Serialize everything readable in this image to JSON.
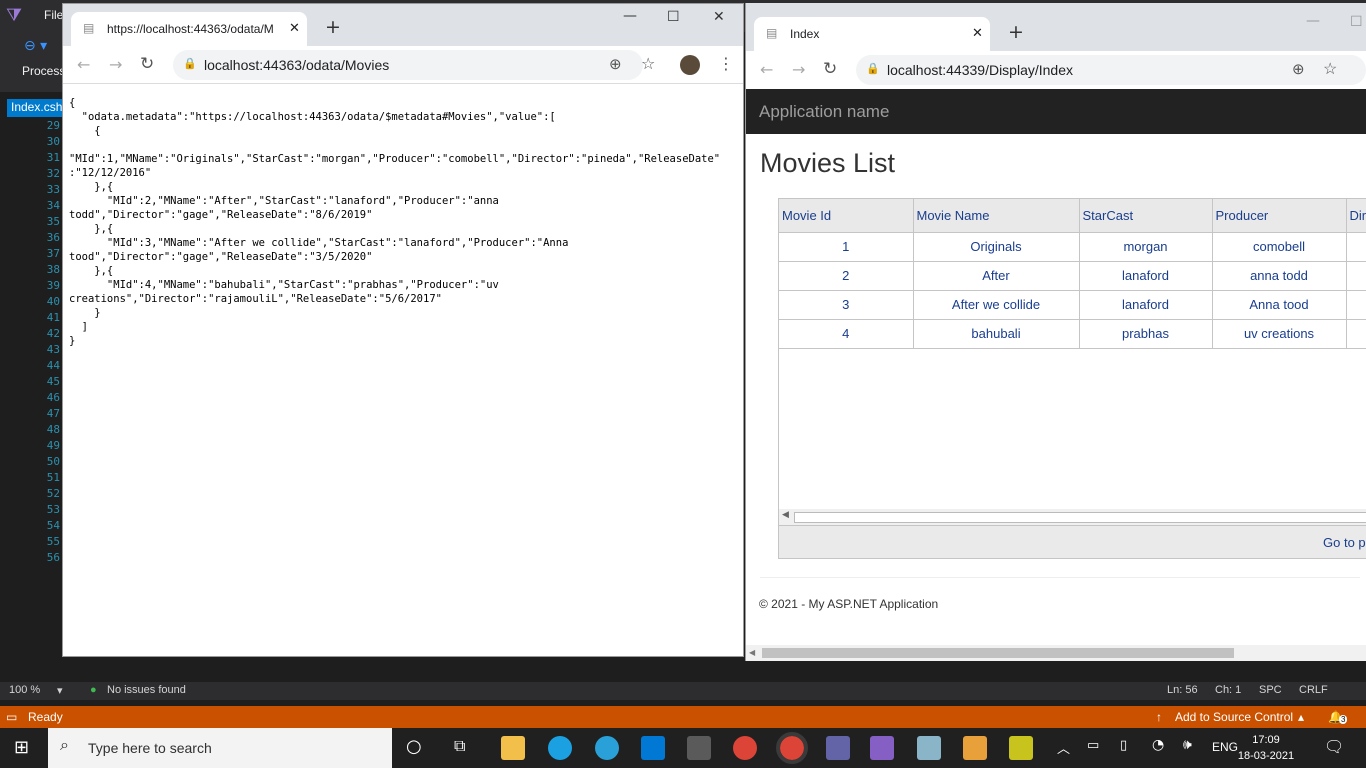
{
  "vs": {
    "menu_file": "File",
    "toolbar_process": "Process",
    "doc_tab": "Index.cshtml",
    "line_numbers": [
      "29",
      "30",
      "31",
      "32",
      "33",
      "34",
      "35",
      "36",
      "37",
      "38",
      "39",
      "40",
      "41",
      "42",
      "43",
      "44",
      "45",
      "46",
      "47",
      "48",
      "49",
      "50",
      "51",
      "52",
      "53",
      "54",
      "55",
      "56"
    ],
    "zoom": "100 %",
    "issues": "No issues found",
    "ln": "Ln: 56",
    "ch": "Ch: 1",
    "spc": "SPC",
    "crlf": "CRLF",
    "ready": "Ready",
    "source_control": "Add to Source Control",
    "notification_count": "3"
  },
  "browser1": {
    "tab_title": "https://localhost:44363/odata/M",
    "url": "localhost:44363/odata/Movies",
    "json_lines": [
      "{",
      "  \"odata.metadata\":\"https://localhost:44363/odata/$metadata#Movies\",\"value\":[",
      "    {",
      "",
      "\"MId\":1,\"MName\":\"Originals\",\"StarCast\":\"morgan\",\"Producer\":\"comobell\",\"Director\":\"pineda\",\"ReleaseDate\"",
      ":\"12/12/2016\"",
      "    },{",
      "      \"MId\":2,\"MName\":\"After\",\"StarCast\":\"lanaford\",\"Producer\":\"anna",
      "todd\",\"Director\":\"gage\",\"ReleaseDate\":\"8/6/2019\"",
      "    },{",
      "      \"MId\":3,\"MName\":\"After we collide\",\"StarCast\":\"lanaford\",\"Producer\":\"Anna",
      "tood\",\"Director\":\"gage\",\"ReleaseDate\":\"3/5/2020\"",
      "    },{",
      "      \"MId\":4,\"MName\":\"bahubali\",\"StarCast\":\"prabhas\",\"Producer\":\"uv",
      "creations\",\"Director\":\"rajamouliL\",\"ReleaseDate\":\"5/6/2017\"",
      "    }",
      "  ]",
      "}"
    ]
  },
  "browser2": {
    "tab_title": "Index",
    "url": "localhost:44339/Display/Index",
    "app_name": "Application name",
    "heading": "Movies List",
    "columns": [
      "Movie Id",
      "Movie Name",
      "StarCast",
      "Producer",
      "Dire"
    ],
    "rows": [
      [
        "1",
        "Originals",
        "morgan",
        "comobell",
        ""
      ],
      [
        "2",
        "After",
        "lanaford",
        "anna todd",
        ""
      ],
      [
        "3",
        "After we collide",
        "lanaford",
        "Anna tood",
        ""
      ],
      [
        "4",
        "bahubali",
        "prabhas",
        "uv creations",
        ""
      ]
    ],
    "pager": "Go to p",
    "footer": "© 2021 - My ASP.NET Application"
  },
  "taskbar": {
    "search_placeholder": "Type here to search",
    "lang": "ENG",
    "time": "17:09",
    "date": "18-03-2021"
  }
}
